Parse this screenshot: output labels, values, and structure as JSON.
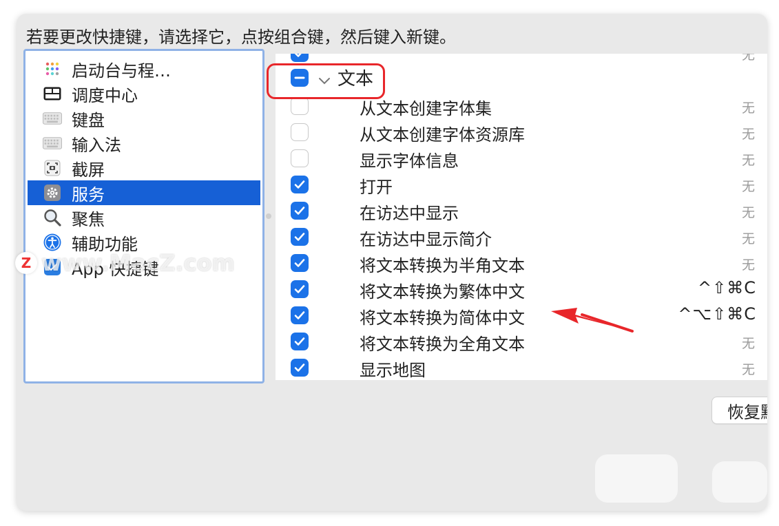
{
  "instruction": "若要更改快捷键，请选择它，点按组合键，然后键入新键。",
  "sidebar": {
    "items": [
      {
        "label": "启动台与程…",
        "icon": "launchpad-icon",
        "selected": false
      },
      {
        "label": "调度中心",
        "icon": "mission-control-icon",
        "selected": false
      },
      {
        "label": "键盘",
        "icon": "keyboard-icon",
        "selected": false
      },
      {
        "label": "输入法",
        "icon": "input-source-icon",
        "selected": false
      },
      {
        "label": "截屏",
        "icon": "screenshot-icon",
        "selected": false
      },
      {
        "label": "服务",
        "icon": "gear-icon",
        "selected": true
      },
      {
        "label": "聚焦",
        "icon": "spotlight-icon",
        "selected": false
      },
      {
        "label": "辅助功能",
        "icon": "accessibility-icon",
        "selected": false
      },
      {
        "label": "App 快捷键",
        "icon": "app-shortcuts-icon",
        "selected": false
      }
    ]
  },
  "services_list": {
    "group": {
      "label": "文本",
      "state": "mixed",
      "expanded": true
    },
    "rows": [
      {
        "label": "从文本创建字体集",
        "checked": false,
        "shortcut": "无"
      },
      {
        "label": "从文本创建字体资源库",
        "checked": false,
        "shortcut": "无"
      },
      {
        "label": "显示字体信息",
        "checked": false,
        "shortcut": "无"
      },
      {
        "label": "打开",
        "checked": true,
        "shortcut": "无"
      },
      {
        "label": "在访达中显示",
        "checked": true,
        "shortcut": "无"
      },
      {
        "label": "在访达中显示简介",
        "checked": true,
        "shortcut": "无"
      },
      {
        "label": "将文本转换为半角文本",
        "checked": true,
        "shortcut": "无"
      },
      {
        "label": "将文本转换为繁体中文",
        "checked": true,
        "shortcut": "^⇧⌘C"
      },
      {
        "label": "将文本转换为简体中文",
        "checked": true,
        "shortcut": "^⌥⇧⌘C"
      },
      {
        "label": "将文本转换为全角文本",
        "checked": true,
        "shortcut": "无"
      },
      {
        "label": "显示地图",
        "checked": true,
        "shortcut": "无"
      }
    ],
    "partial_top_row": {
      "shortcut": "无",
      "checked": true
    }
  },
  "buttons": {
    "restore_label": "恢复默认"
  },
  "watermark": {
    "text": "www.MacZ.com"
  },
  "colors": {
    "accent": "#1b72e8",
    "selected_bg": "#1660d6",
    "annotation_red": "#e8262a"
  }
}
